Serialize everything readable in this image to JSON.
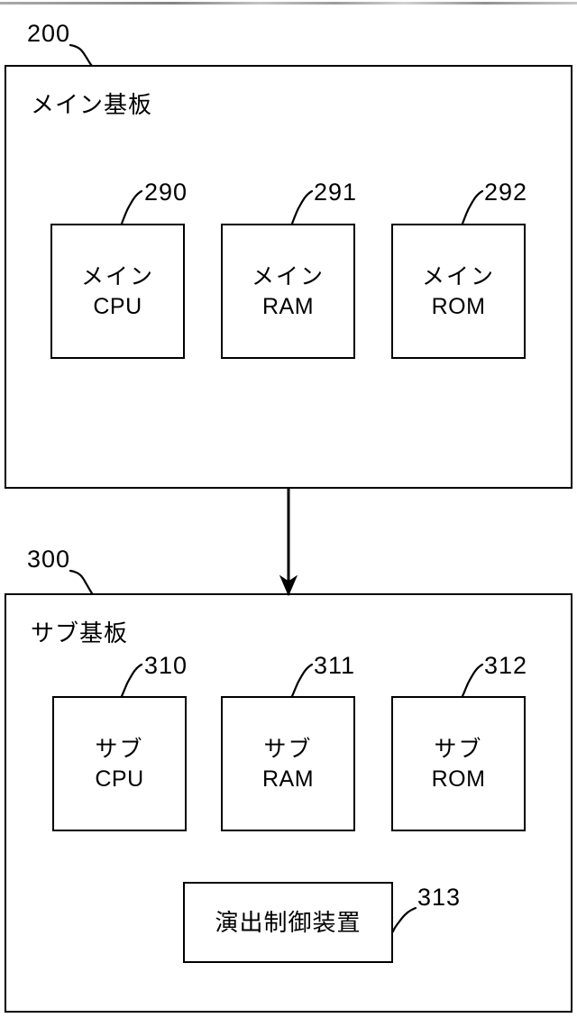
{
  "figure": {
    "type": "patent-block-diagram",
    "header_artifact": "",
    "boards": [
      {
        "ref": "200",
        "title": "メイン基板",
        "chips": [
          {
            "ref": "290",
            "line1": "メイン",
            "line2": "CPU"
          },
          {
            "ref": "291",
            "line1": "メイン",
            "line2": "RAM"
          },
          {
            "ref": "292",
            "line1": "メイン",
            "line2": "ROM"
          }
        ]
      },
      {
        "ref": "300",
        "title": "サブ基板",
        "chips": [
          {
            "ref": "310",
            "line1": "サブ",
            "line2": "CPU"
          },
          {
            "ref": "311",
            "line1": "サブ",
            "line2": "RAM"
          },
          {
            "ref": "312",
            "line1": "サブ",
            "line2": "ROM"
          },
          {
            "ref": "313",
            "line1": "演出制御装置",
            "line2": ""
          }
        ]
      }
    ],
    "connector": {
      "name": "main-to-sub-arrow",
      "direction": "down"
    },
    "colors": {
      "ink": "#000000",
      "paper": "#ffffff"
    }
  }
}
